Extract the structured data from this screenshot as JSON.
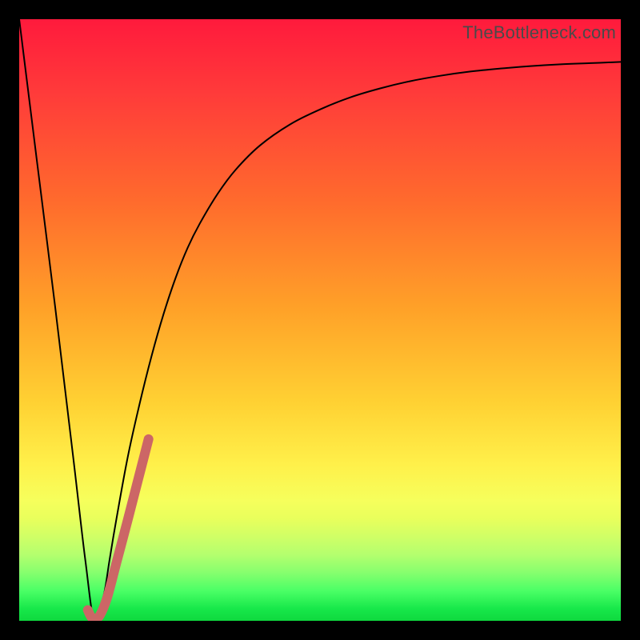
{
  "watermark": "TheBottleneck.com",
  "chart_data": {
    "type": "line",
    "title": "",
    "xlabel": "",
    "ylabel": "",
    "xlim": [
      0,
      100
    ],
    "ylim": [
      0,
      100
    ],
    "grid": false,
    "series": [
      {
        "name": "black-curve",
        "color": "#000000",
        "stroke_width": 2,
        "x": [
          0,
          3,
          6,
          9,
          11,
          12.5,
          14,
          15,
          16,
          18,
          20,
          22,
          24,
          26,
          28,
          30,
          33,
          36,
          40,
          45,
          50,
          55,
          60,
          65,
          70,
          75,
          80,
          85,
          90,
          95,
          100
        ],
        "y": [
          100,
          76,
          52,
          27,
          10,
          0,
          4,
          10,
          16,
          27,
          36,
          44,
          51,
          57,
          62,
          66,
          71,
          75,
          79,
          82.5,
          85,
          87,
          88.5,
          89.7,
          90.6,
          91.3,
          91.8,
          92.2,
          92.5,
          92.7,
          92.9
        ]
      },
      {
        "name": "pink-highlight",
        "color": "#cc6666",
        "stroke_width": 12,
        "x": [
          11.4,
          12.0,
          12.6,
          13.4,
          14.6,
          16.2,
          18.0,
          19.8,
          21.5
        ],
        "y": [
          1.8,
          0.6,
          0.4,
          0.9,
          3.8,
          9.8,
          16.6,
          23.6,
          30.2
        ]
      }
    ]
  }
}
